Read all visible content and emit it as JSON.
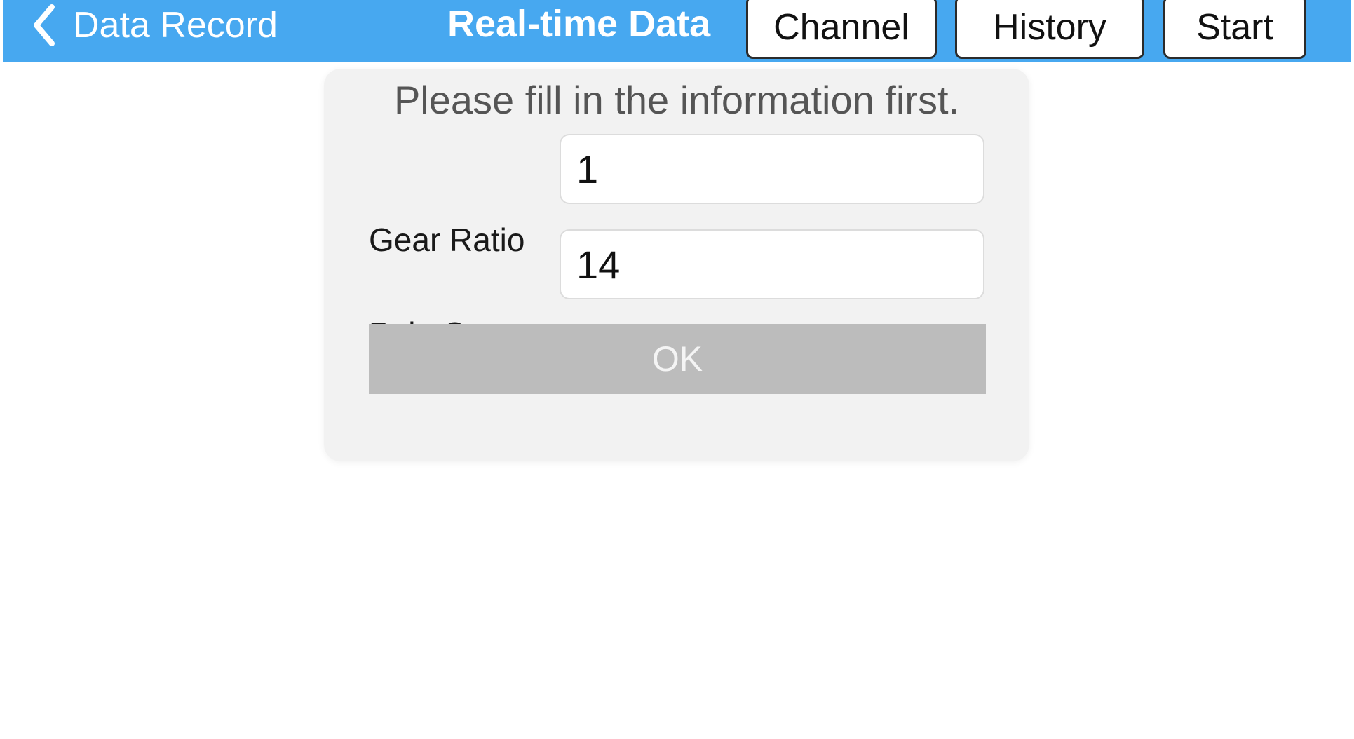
{
  "navbar": {
    "back_label": "Data Record",
    "back_icon": "chevron-left-icon",
    "title": "Real-time Data",
    "buttons": {
      "channel": "Channel",
      "history": "History",
      "start": "Start"
    },
    "background_color": "#47a8f0"
  },
  "dialog": {
    "message": "Please fill in the information first.",
    "fields": [
      {
        "label": "Gear Ratio",
        "value": "1"
      },
      {
        "label": "Pole Count",
        "value": "14"
      }
    ],
    "ok_label": "OK",
    "ok_button_color": "#bcbcbc"
  }
}
